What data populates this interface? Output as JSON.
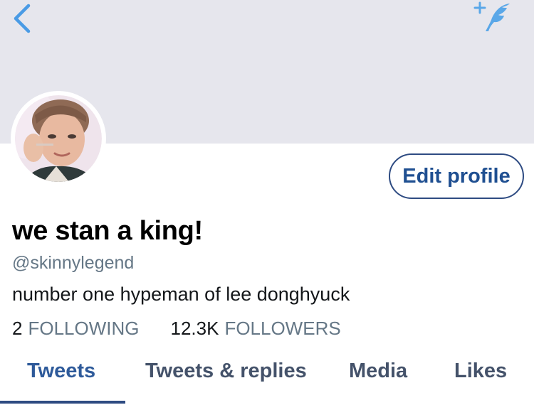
{
  "profile": {
    "display_name": "we stan a king!",
    "handle": "@skinnylegend",
    "bio": "number one hypeman of lee donghyuck"
  },
  "actions": {
    "edit_label": "Edit profile",
    "back_icon": "chevron-left-icon",
    "compose_icon": "compose-feather-icon"
  },
  "stats": {
    "following_count": "2",
    "following_label": "FOLLOWING",
    "followers_count": "12.3K",
    "followers_label": "FOLLOWERS"
  },
  "tabs": [
    {
      "label": "Tweets",
      "active": true
    },
    {
      "label": "Tweets & replies",
      "active": false
    },
    {
      "label": "Media",
      "active": false
    },
    {
      "label": "Likes",
      "active": false
    }
  ],
  "colors": {
    "accent": "#1da1f2",
    "header_bg": "#e6e6ed",
    "button_border": "#2e4b82",
    "secondary_text": "#657786"
  }
}
